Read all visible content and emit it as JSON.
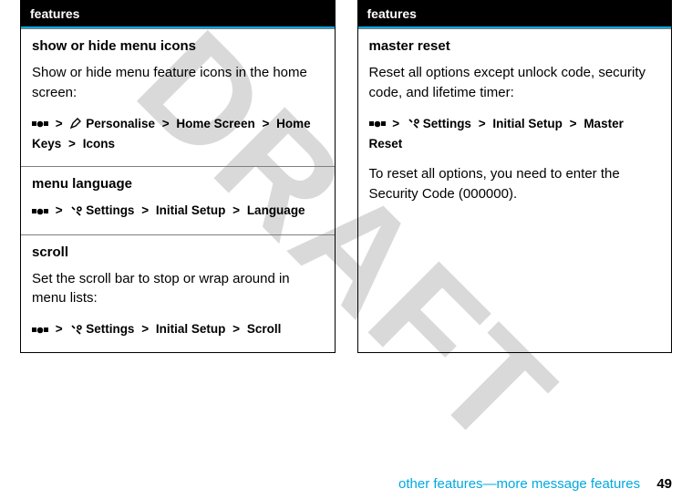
{
  "watermark": "DRAFT",
  "left": {
    "header": "features",
    "sections": [
      {
        "title": "show or hide menu icons",
        "body": "Show or hide menu feature icons in the home screen:",
        "path": {
          "lead_icon": "key",
          "second_icon": "pencil",
          "second_label": "Personalise",
          "rest": [
            "Home Screen",
            "Home Keys",
            "Icons"
          ]
        }
      },
      {
        "title": "menu language",
        "body": "",
        "path": {
          "lead_icon": "key",
          "second_icon": "tool",
          "second_label": "Settings",
          "rest": [
            "Initial Setup",
            "Language"
          ]
        }
      },
      {
        "title": "scroll",
        "body": "Set the scroll bar to stop or wrap around in menu lists:",
        "path": {
          "lead_icon": "key",
          "second_icon": "tool",
          "second_label": "Settings",
          "rest": [
            "Initial Setup",
            "Scroll"
          ]
        }
      }
    ]
  },
  "right": {
    "header": "features",
    "sections": [
      {
        "title": "master reset",
        "body": "Reset all options except unlock code, security code, and lifetime timer:",
        "path": {
          "lead_icon": "key",
          "second_icon": "tool",
          "second_label": "Settings",
          "rest": [
            "Initial Setup",
            "Master Reset"
          ]
        },
        "after_pre": "To reset all options, you need to enter the ",
        "after_bold1": "Security Code",
        "after_mid": " (",
        "after_bold2": "000000",
        "after_post": ")."
      }
    ]
  },
  "footer": {
    "text": "other features—more message features",
    "page": "49"
  }
}
